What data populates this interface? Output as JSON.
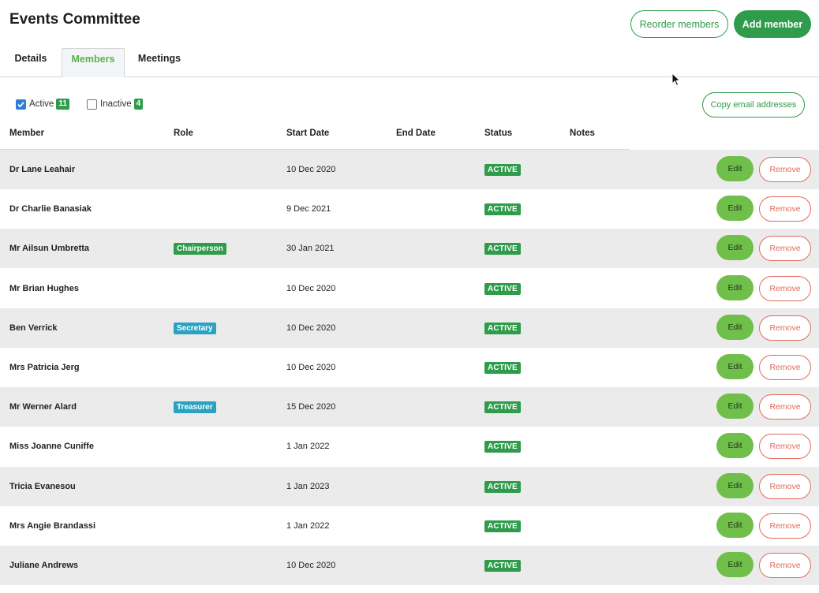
{
  "page": {
    "title": "Events Committee",
    "reorder_label": "Reorder members",
    "add_label": "Add member"
  },
  "tabs": [
    {
      "label": "Details",
      "active": false
    },
    {
      "label": "Members",
      "active": true
    },
    {
      "label": "Meetings",
      "active": false
    }
  ],
  "filters": {
    "active_label": "Active",
    "active_count": "11",
    "active_checked": true,
    "inactive_label": "Inactive",
    "inactive_count": "4",
    "inactive_checked": false,
    "copy_label": "Copy email addresses"
  },
  "columns": [
    "Member",
    "Role",
    "Start Date",
    "End Date",
    "Status",
    "Notes"
  ],
  "actions": {
    "edit": "Edit",
    "remove": "Remove"
  },
  "role_colors": {
    "Chairperson": "#2e9c4a",
    "Secretary": "#2aa3c2",
    "Treasurer": "#2aa3c2"
  },
  "colors": {
    "brand": "#2e9c4a",
    "edit": "#6fbf4a",
    "remove": "#e06b5a",
    "checkbox": "#2f7fd8"
  },
  "members": [
    {
      "name": "Dr Lane Leahair",
      "role": "",
      "start": "10 Dec 2020",
      "end": "",
      "status": "ACTIVE",
      "notes": ""
    },
    {
      "name": "Dr Charlie Banasiak",
      "role": "",
      "start": "9 Dec 2021",
      "end": "",
      "status": "ACTIVE",
      "notes": ""
    },
    {
      "name": "Mr Ailsun Umbretta",
      "role": "Chairperson",
      "start": "30 Jan 2021",
      "end": "",
      "status": "ACTIVE",
      "notes": ""
    },
    {
      "name": "Mr Brian Hughes",
      "role": "",
      "start": "10 Dec 2020",
      "end": "",
      "status": "ACTIVE",
      "notes": ""
    },
    {
      "name": "Ben Verrick",
      "role": "Secretary",
      "start": "10 Dec 2020",
      "end": "",
      "status": "ACTIVE",
      "notes": ""
    },
    {
      "name": "Mrs Patricia Jerg",
      "role": "",
      "start": "10 Dec 2020",
      "end": "",
      "status": "ACTIVE",
      "notes": ""
    },
    {
      "name": "Mr Werner Alard",
      "role": "Treasurer",
      "start": "15 Dec 2020",
      "end": "",
      "status": "ACTIVE",
      "notes": ""
    },
    {
      "name": "Miss Joanne Cuniffe",
      "role": "",
      "start": "1 Jan 2022",
      "end": "",
      "status": "ACTIVE",
      "notes": ""
    },
    {
      "name": "Tricia Evanesou",
      "role": "",
      "start": "1 Jan 2023",
      "end": "",
      "status": "ACTIVE",
      "notes": ""
    },
    {
      "name": "Mrs Angie Brandassi",
      "role": "",
      "start": "1 Jan 2022",
      "end": "",
      "status": "ACTIVE",
      "notes": ""
    },
    {
      "name": "Juliane Andrews",
      "role": "",
      "start": "10 Dec 2020",
      "end": "",
      "status": "ACTIVE",
      "notes": ""
    }
  ]
}
